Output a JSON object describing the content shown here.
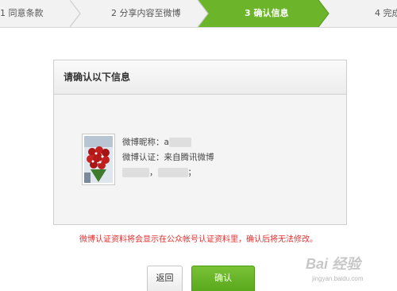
{
  "steps": [
    {
      "label": "1 同意条款",
      "active": false
    },
    {
      "label": "2 分享内容至微博",
      "active": false
    },
    {
      "label": "3 确认信息",
      "active": true
    },
    {
      "label": "4 完成",
      "active": false
    }
  ],
  "colors": {
    "accent_green": "#6cb52a",
    "warning_red": "#e03030",
    "step_bg": "#f2f2f2"
  },
  "panel": {
    "title": "请确认以下信息",
    "nickname_label": "微博昵称：a",
    "verification_label": "微博认证：来自腾讯微博",
    "detail_separator_1": "，",
    "detail_separator_2": "；"
  },
  "warning_text": "微博认证资料将会显示在公众帐号认证资料里，确认后将无法修改。",
  "buttons": {
    "back": "返回",
    "confirm": "确认"
  },
  "watermark": {
    "brand": "Bai 经验",
    "url": "jingyan.baidu.com"
  }
}
